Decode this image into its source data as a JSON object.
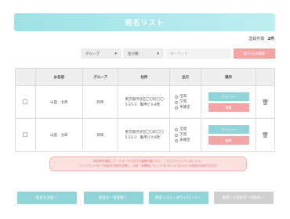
{
  "header": {
    "title": "宛名リスト"
  },
  "count": {
    "label": "登録件数",
    "value": "2件"
  },
  "filters": {
    "group": "グループ",
    "sort": "並び順",
    "keyword_placeholder": "キーワード",
    "search_button": "絞り込み検索"
  },
  "table": {
    "headers": [
      "お名前",
      "グループ",
      "住所",
      "出欠",
      "操作"
    ],
    "rows": [
      {
        "name": "山田　太郎",
        "group": "新郎",
        "address_line1": "東京都渋谷区〇〇町〇〇",
        "address_line2": "5-21-3　亀甲ビル4階",
        "attendance": [
          "出席",
          "欠席",
          "未確定"
        ],
        "preview": "プレビュー",
        "edit": "編集"
      },
      {
        "name": "山田　太郎",
        "group": "新郎",
        "address_line1": "東京都渋谷区〇〇町〇〇",
        "address_line2": "5-21-3　亀甲ビル4階",
        "attendance": [
          "出席",
          "欠席",
          "未確定"
        ],
        "preview": "プレビュー",
        "edit": "編集"
      }
    ]
  },
  "notice": {
    "line1": "宛名等を確定して、テストから出力の連絡が届いたら、こちらにチェックしましょう。",
    "line2": "ワンサプレーターで宛名を作成する際に、氏名・未確認にチェックがついているゲストの宛名が反映されます"
  },
  "bottom_buttons": {
    "add": "宛名を追加 〉",
    "bulk_edit": "宛名を一括登録 〉",
    "download": "宛名リスト・ダウンロード 〉",
    "delete": "選択した宛名を一括削除 〉"
  }
}
